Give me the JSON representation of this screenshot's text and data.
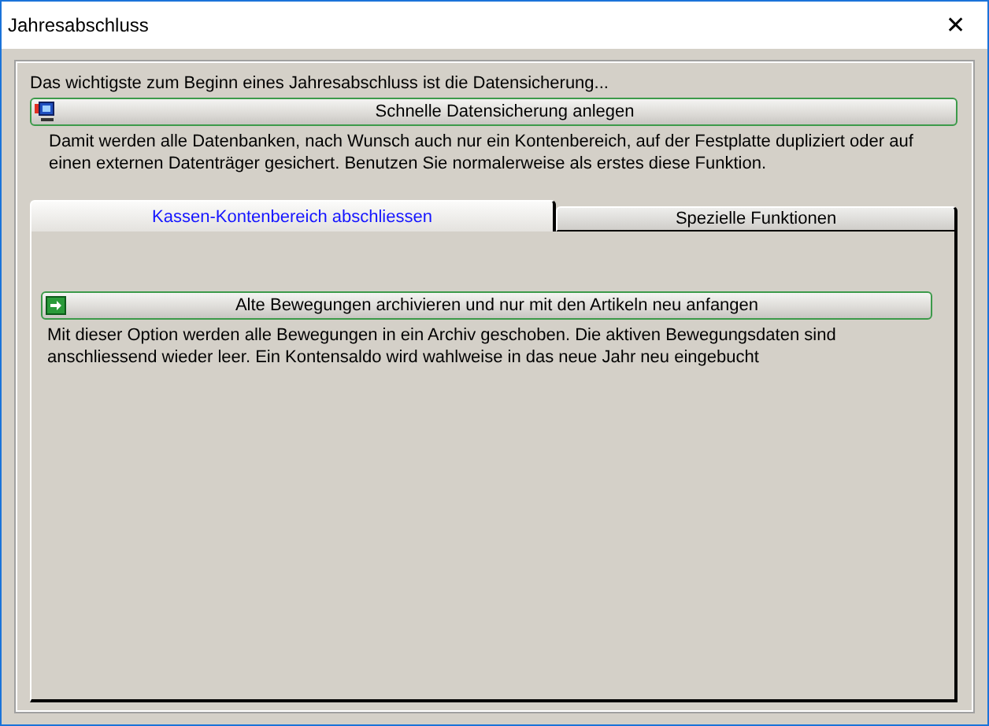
{
  "window": {
    "title": "Jahresabschluss",
    "close": "✕"
  },
  "intro": "Das wichtigste zum Beginn eines Jahresabschluss ist die Datensicherung...",
  "backup": {
    "label": "Schnelle Datensicherung anlegen",
    "description": "Damit werden alle Datenbanken, nach Wunsch auch nur ein Kontenbereich, auf der Festplatte dupliziert oder auf einen externen Datenträger gesichert. Benutzen Sie normalerweise als erstes diese Funktion."
  },
  "tabs": [
    {
      "label": "Kassen-Kontenbereich abschliessen",
      "selected": true
    },
    {
      "label": "Spezielle Funktionen",
      "selected": false
    }
  ],
  "archive": {
    "label": "Alte Bewegungen archivieren und nur mit den Artikeln neu anfangen",
    "description": "Mit dieser Option werden alle Bewegungen in ein Archiv geschoben. Die aktiven Bewegungsdaten sind anschliessend wieder leer. Ein Kontensaldo wird wahlweise in das neue Jahr neu eingebucht"
  }
}
